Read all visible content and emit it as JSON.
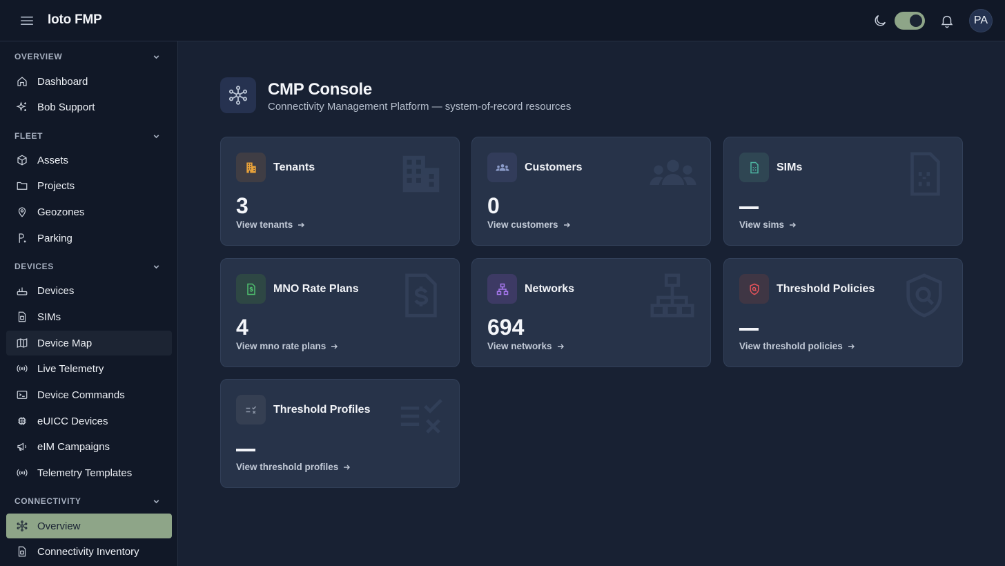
{
  "app": {
    "title": "Ioto FMP",
    "avatar_initials": "PA",
    "theme_toggle_on": true
  },
  "sidebar": {
    "sections": [
      {
        "label": "OVERVIEW",
        "items": [
          {
            "label": "Dashboard",
            "icon": "home-icon"
          },
          {
            "label": "Bob Support",
            "icon": "sparkles-icon"
          }
        ]
      },
      {
        "label": "FLEET",
        "items": [
          {
            "label": "Assets",
            "icon": "cube-icon"
          },
          {
            "label": "Projects",
            "icon": "folder-icon"
          },
          {
            "label": "Geozones",
            "icon": "map-pin-icon"
          },
          {
            "label": "Parking",
            "icon": "parking-icon"
          }
        ]
      },
      {
        "label": "DEVICES",
        "items": [
          {
            "label": "Devices",
            "icon": "router-icon"
          },
          {
            "label": "SIMs",
            "icon": "sim-icon"
          },
          {
            "label": "Device Map",
            "icon": "map-icon"
          },
          {
            "label": "Live Telemetry",
            "icon": "broadcast-icon"
          },
          {
            "label": "Device Commands",
            "icon": "terminal-icon"
          },
          {
            "label": "eUICC Devices",
            "icon": "chip-icon"
          },
          {
            "label": "eIM Campaigns",
            "icon": "megaphone-icon"
          },
          {
            "label": "Telemetry Templates",
            "icon": "broadcast-icon"
          }
        ]
      },
      {
        "label": "CONNECTIVITY",
        "items": [
          {
            "label": "Overview",
            "icon": "network-icon",
            "active": true
          },
          {
            "label": "Connectivity Inventory",
            "icon": "sim-icon"
          }
        ]
      }
    ]
  },
  "main": {
    "title": "CMP Console",
    "subtitle": "Connectivity Management Platform — system-of-record resources",
    "cards": [
      {
        "title": "Tenants",
        "value": "3",
        "link": "View tenants",
        "icon": "building-icon",
        "accent": "#e8a23a"
      },
      {
        "title": "Customers",
        "value": "0",
        "link": "View customers",
        "icon": "users-icon",
        "accent": "#8a9ac8"
      },
      {
        "title": "SIMs",
        "value": "—",
        "link": "View sims",
        "icon": "sim-icon",
        "accent": "#4fb7a3"
      },
      {
        "title": "MNO Rate Plans",
        "value": "4",
        "link": "View mno rate plans",
        "icon": "invoice-dollar-icon",
        "accent": "#4fbf6e"
      },
      {
        "title": "Networks",
        "value": "694",
        "link": "View networks",
        "icon": "hierarchy-icon",
        "accent": "#a878f0"
      },
      {
        "title": "Threshold Policies",
        "value": "—",
        "link": "View threshold policies",
        "icon": "shield-search-icon",
        "accent": "#e5535a"
      },
      {
        "title": "Threshold Profiles",
        "value": "—",
        "link": "View threshold profiles",
        "icon": "list-check-icon",
        "accent": "#8d97a8"
      }
    ]
  }
}
